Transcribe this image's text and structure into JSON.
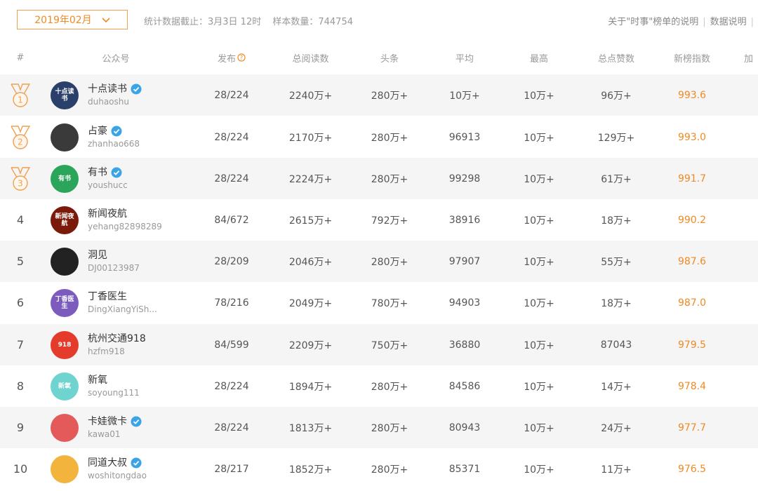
{
  "topbar": {
    "month": "2019年02月",
    "deadline": "统计数据截止：3月3日 12时",
    "sample": "样本数量：744754",
    "link_about": "关于\"时事\"榜单的说明",
    "link_data": "数据说明"
  },
  "columns": {
    "rank": "#",
    "account": "公众号",
    "publish": "发布",
    "total_reads": "总阅读数",
    "headline": "头条",
    "average": "平均",
    "max": "最高",
    "likes": "总点赞数",
    "index": "新榜指数",
    "more": "加"
  },
  "colors": {
    "accent": "#f08a24",
    "verified": "#3aa4e6",
    "medal": "#f0a050"
  },
  "rows": [
    {
      "rank": "1",
      "name": "十点读书",
      "id": "duhaoshu",
      "verified": true,
      "publish": "28/224",
      "total": "2240万+",
      "headline": "280万+",
      "avg": "10万+",
      "max": "10万+",
      "likes": "96万+",
      "index": "993.6"
    },
    {
      "rank": "2",
      "name": "占豪",
      "id": "zhanhao668",
      "verified": true,
      "publish": "28/224",
      "total": "2170万+",
      "headline": "280万+",
      "avg": "96913",
      "max": "10万+",
      "likes": "129万+",
      "index": "993.0"
    },
    {
      "rank": "3",
      "name": "有书",
      "id": "youshucc",
      "verified": true,
      "publish": "28/224",
      "total": "2224万+",
      "headline": "280万+",
      "avg": "99298",
      "max": "10万+",
      "likes": "61万+",
      "index": "991.7"
    },
    {
      "rank": "4",
      "name": "新闻夜航",
      "id": "yehang82898289",
      "verified": false,
      "publish": "84/672",
      "total": "2615万+",
      "headline": "792万+",
      "avg": "38916",
      "max": "10万+",
      "likes": "18万+",
      "index": "990.2"
    },
    {
      "rank": "5",
      "name": "洞见",
      "id": "DJ00123987",
      "verified": false,
      "publish": "28/209",
      "total": "2046万+",
      "headline": "280万+",
      "avg": "97907",
      "max": "10万+",
      "likes": "55万+",
      "index": "987.6"
    },
    {
      "rank": "6",
      "name": "丁香医生",
      "id": "DingXiangYiSh...",
      "verified": false,
      "publish": "78/216",
      "total": "2049万+",
      "headline": "780万+",
      "avg": "94903",
      "max": "10万+",
      "likes": "18万+",
      "index": "987.0"
    },
    {
      "rank": "7",
      "name": "杭州交通918",
      "id": "hzfm918",
      "verified": false,
      "publish": "84/599",
      "total": "2209万+",
      "headline": "750万+",
      "avg": "36880",
      "max": "10万+",
      "likes": "87043",
      "index": "979.5"
    },
    {
      "rank": "8",
      "name": "新氧",
      "id": "soyoung111",
      "verified": false,
      "publish": "28/224",
      "total": "1894万+",
      "headline": "280万+",
      "avg": "84586",
      "max": "10万+",
      "likes": "14万+",
      "index": "978.4"
    },
    {
      "rank": "9",
      "name": "卡娃微卡",
      "id": "kawa01",
      "verified": true,
      "publish": "28/224",
      "total": "1813万+",
      "headline": "280万+",
      "avg": "80943",
      "max": "10万+",
      "likes": "24万+",
      "index": "977.7"
    },
    {
      "rank": "10",
      "name": "同道大叔",
      "id": "woshitongdao",
      "verified": true,
      "publish": "28/217",
      "total": "1852万+",
      "headline": "280万+",
      "avg": "85371",
      "max": "10万+",
      "likes": "11万+",
      "index": "976.5"
    }
  ],
  "avatars": [
    {
      "label": "十点读书",
      "bg": "#2b3f6b"
    },
    {
      "label": "",
      "bg": "#3a3a3a"
    },
    {
      "label": "有书",
      "bg": "#2aa55a"
    },
    {
      "label": "新闻夜航",
      "bg": "#7a1a0a"
    },
    {
      "label": "",
      "bg": "#222222"
    },
    {
      "label": "丁香医生",
      "bg": "#7b5bbd"
    },
    {
      "label": "918",
      "bg": "#e53b2c"
    },
    {
      "label": "新氧",
      "bg": "#6fd4d0"
    },
    {
      "label": "",
      "bg": "#e45a5a"
    },
    {
      "label": "",
      "bg": "#f2b43c"
    }
  ]
}
